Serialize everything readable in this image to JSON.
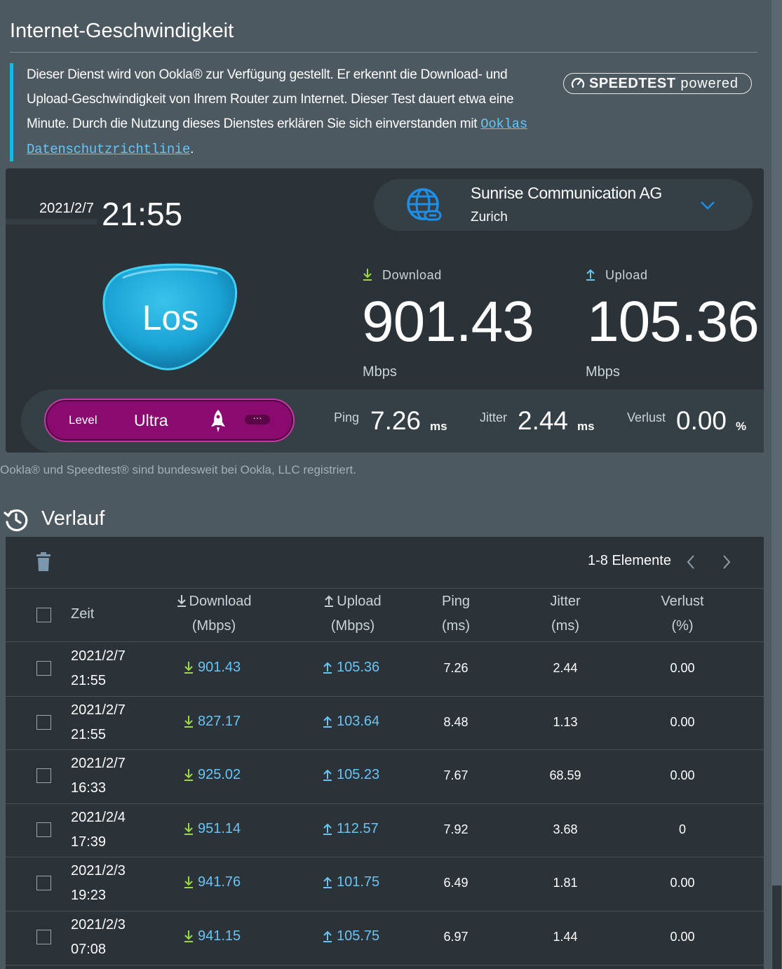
{
  "page_title": "Internet-Geschwindigkeit",
  "info": {
    "text": "Dieser Dienst wird von Ookla® zur Verfügung gestellt. Er erkennt die Download- und Upload-Geschwindigkeit von Ihrem Router zum Internet. Dieser Test dauert etwa eine Minute. Durch die Nutzung dieses Dienstes erklären Sie sich einverstanden mit ",
    "link_label": "Ooklas Datenschutzrichtlinie",
    "suffix": "."
  },
  "badge": {
    "brand": "SPEEDTEST",
    "suffix": "powered"
  },
  "test": {
    "date": "2021/2/7",
    "time": "21:55",
    "server_name": "Sunrise Communication AG",
    "server_city": "Zurich",
    "go_label": "Los",
    "download_label": "Download",
    "upload_label": "Upload",
    "download_value": "901.43",
    "upload_value": "105.36",
    "unit": "Mbps",
    "level_label": "Level",
    "level_value": "Ultra",
    "dots": "···",
    "ping_label": "Ping",
    "ping_value": "7.26",
    "ping_unit": "ms",
    "jitter_label": "Jitter",
    "jitter_value": "2.44",
    "jitter_unit": "ms",
    "loss_label": "Verlust",
    "loss_value": "0.00",
    "loss_unit": "%"
  },
  "footnote": "Ookla® und Speedtest® sind bundesweit bei Ookla, LLC registriert.",
  "history": {
    "title": "Verlauf",
    "pager": "1-8 Elemente",
    "headers": {
      "time": "Zeit",
      "download": "Download",
      "download_unit": "(Mbps)",
      "upload": "Upload",
      "upload_unit": "(Mbps)",
      "ping": "Ping",
      "ping_unit": "(ms)",
      "jitter": "Jitter",
      "jitter_unit": "(ms)",
      "loss": "Verlust",
      "loss_unit": "(%)"
    },
    "rows": [
      {
        "date": "2021/2/7",
        "time": "21:55",
        "download": "901.43",
        "upload": "105.36",
        "ping": "7.26",
        "jitter": "2.44",
        "loss": "0.00"
      },
      {
        "date": "2021/2/7",
        "time": "21:55",
        "download": "827.17",
        "upload": "103.64",
        "ping": "8.48",
        "jitter": "1.13",
        "loss": "0.00"
      },
      {
        "date": "2021/2/7",
        "time": "16:33",
        "download": "925.02",
        "upload": "105.23",
        "ping": "7.67",
        "jitter": "68.59",
        "loss": "0.00"
      },
      {
        "date": "2021/2/4",
        "time": "17:39",
        "download": "951.14",
        "upload": "112.57",
        "ping": "7.92",
        "jitter": "3.68",
        "loss": "0"
      },
      {
        "date": "2021/2/3",
        "time": "19:23",
        "download": "941.76",
        "upload": "101.75",
        "ping": "6.49",
        "jitter": "1.81",
        "loss": "0.00"
      },
      {
        "date": "2021/2/3",
        "time": "07:08",
        "download": "941.15",
        "upload": "105.75",
        "ping": "6.97",
        "jitter": "1.44",
        "loss": "0.00"
      }
    ]
  },
  "colors": {
    "accent": "#69c4f5",
    "level": "#8a0a70",
    "info_bar": "#1fb3e8",
    "download_arrow": "#9ed64a",
    "upload_arrow": "#69c4f5"
  }
}
